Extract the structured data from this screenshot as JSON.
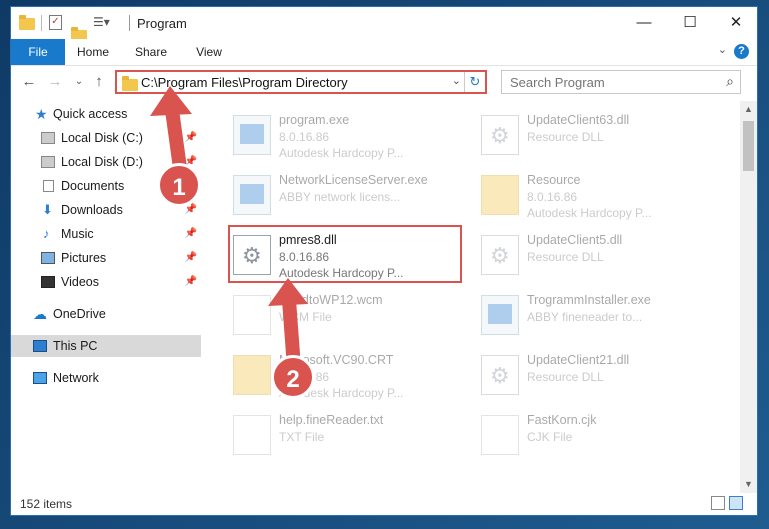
{
  "window": {
    "title": "Program"
  },
  "ribbon": {
    "tabs": [
      "File",
      "Home",
      "Share",
      "View"
    ]
  },
  "address": {
    "path": "C:\\Program Files\\Program Directory"
  },
  "search": {
    "placeholder": "Search Program"
  },
  "sidebar": {
    "items": [
      {
        "label": "Quick access",
        "icon": "star-icon"
      },
      {
        "label": "Local Disk (C:)",
        "icon": "disk-icon",
        "pinned": true
      },
      {
        "label": "Local Disk (D:)",
        "icon": "disk-icon",
        "pinned": true
      },
      {
        "label": "Documents",
        "icon": "documents-icon",
        "pinned": true
      },
      {
        "label": "Downloads",
        "icon": "download-icon",
        "pinned": true
      },
      {
        "label": "Music",
        "icon": "music-icon",
        "pinned": true
      },
      {
        "label": "Pictures",
        "icon": "pictures-icon",
        "pinned": true
      },
      {
        "label": "Videos",
        "icon": "videos-icon",
        "pinned": true
      },
      {
        "label": "OneDrive",
        "icon": "onedrive-icon"
      },
      {
        "label": "This PC",
        "icon": "this-pc-icon",
        "selected": true
      },
      {
        "label": "Network",
        "icon": "network-icon"
      }
    ]
  },
  "files": [
    {
      "name": "program.exe",
      "line1": "8.0.16.86",
      "line2": "Autodesk Hardcopy P...",
      "icon": "exe-icon"
    },
    {
      "name": "UpdateClient63.dll",
      "line1": "Resource DLL",
      "line2": "",
      "icon": "dll-icon"
    },
    {
      "name": "NetworkLicenseServer.exe",
      "line1": "ABBY network licens...",
      "line2": "",
      "icon": "exe-icon"
    },
    {
      "name": "Resource",
      "line1": "8.0.16.86",
      "line2": "Autodesk Hardcopy P...",
      "icon": "folder-icon"
    },
    {
      "name": "pmres8.dll",
      "line1": "8.0.16.86",
      "line2": "Autodesk Hardcopy P...",
      "icon": "dll-icon"
    },
    {
      "name": "UpdateClient5.dll",
      "line1": "Resource DLL",
      "line2": "",
      "icon": "dll-icon"
    },
    {
      "name": "ReadtoWP12.wcm",
      "line1": "WCM File",
      "line2": "",
      "icon": "document-icon"
    },
    {
      "name": "TrogrammInstaller.exe",
      "line1": "ABBY fineneader to...",
      "line2": "",
      "icon": "exe-icon"
    },
    {
      "name": "Microsoft.VC90.CRT",
      "line1": "8.0.16.86",
      "line2": "Autodesk Hardcopy P...",
      "icon": "folder-icon"
    },
    {
      "name": "UpdateClient21.dll",
      "line1": "Resource DLL",
      "line2": "",
      "icon": "dll-icon"
    },
    {
      "name": "help.fineReader.txt",
      "line1": "TXT File",
      "line2": "",
      "icon": "document-icon"
    },
    {
      "name": "FastKorn.cjk",
      "line1": "CJK File",
      "line2": "",
      "icon": "document-icon"
    }
  ],
  "status": {
    "item_count": "152 items"
  },
  "annotations": {
    "badge1": "1",
    "badge2": "2",
    "color": "#d9534f"
  }
}
